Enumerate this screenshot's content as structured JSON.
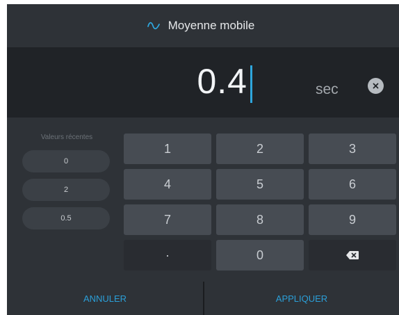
{
  "dialog": {
    "title": "Moyenne mobile",
    "title_icon": "sine-wave-icon",
    "accent_color": "#2ea6dd"
  },
  "display": {
    "value": "0.4",
    "unit": "sec",
    "clear_icon": "clear-x-icon"
  },
  "recent": {
    "title": "Valeurs récentes",
    "values": [
      "0",
      "2",
      "0.5"
    ]
  },
  "keypad": {
    "keys": [
      "1",
      "2",
      "3",
      "4",
      "5",
      "6",
      "7",
      "8",
      "9",
      "·",
      "0"
    ],
    "backspace_icon": "backspace-icon"
  },
  "footer": {
    "cancel_label": "ANNULER",
    "apply_label": "APPLIQUER"
  }
}
